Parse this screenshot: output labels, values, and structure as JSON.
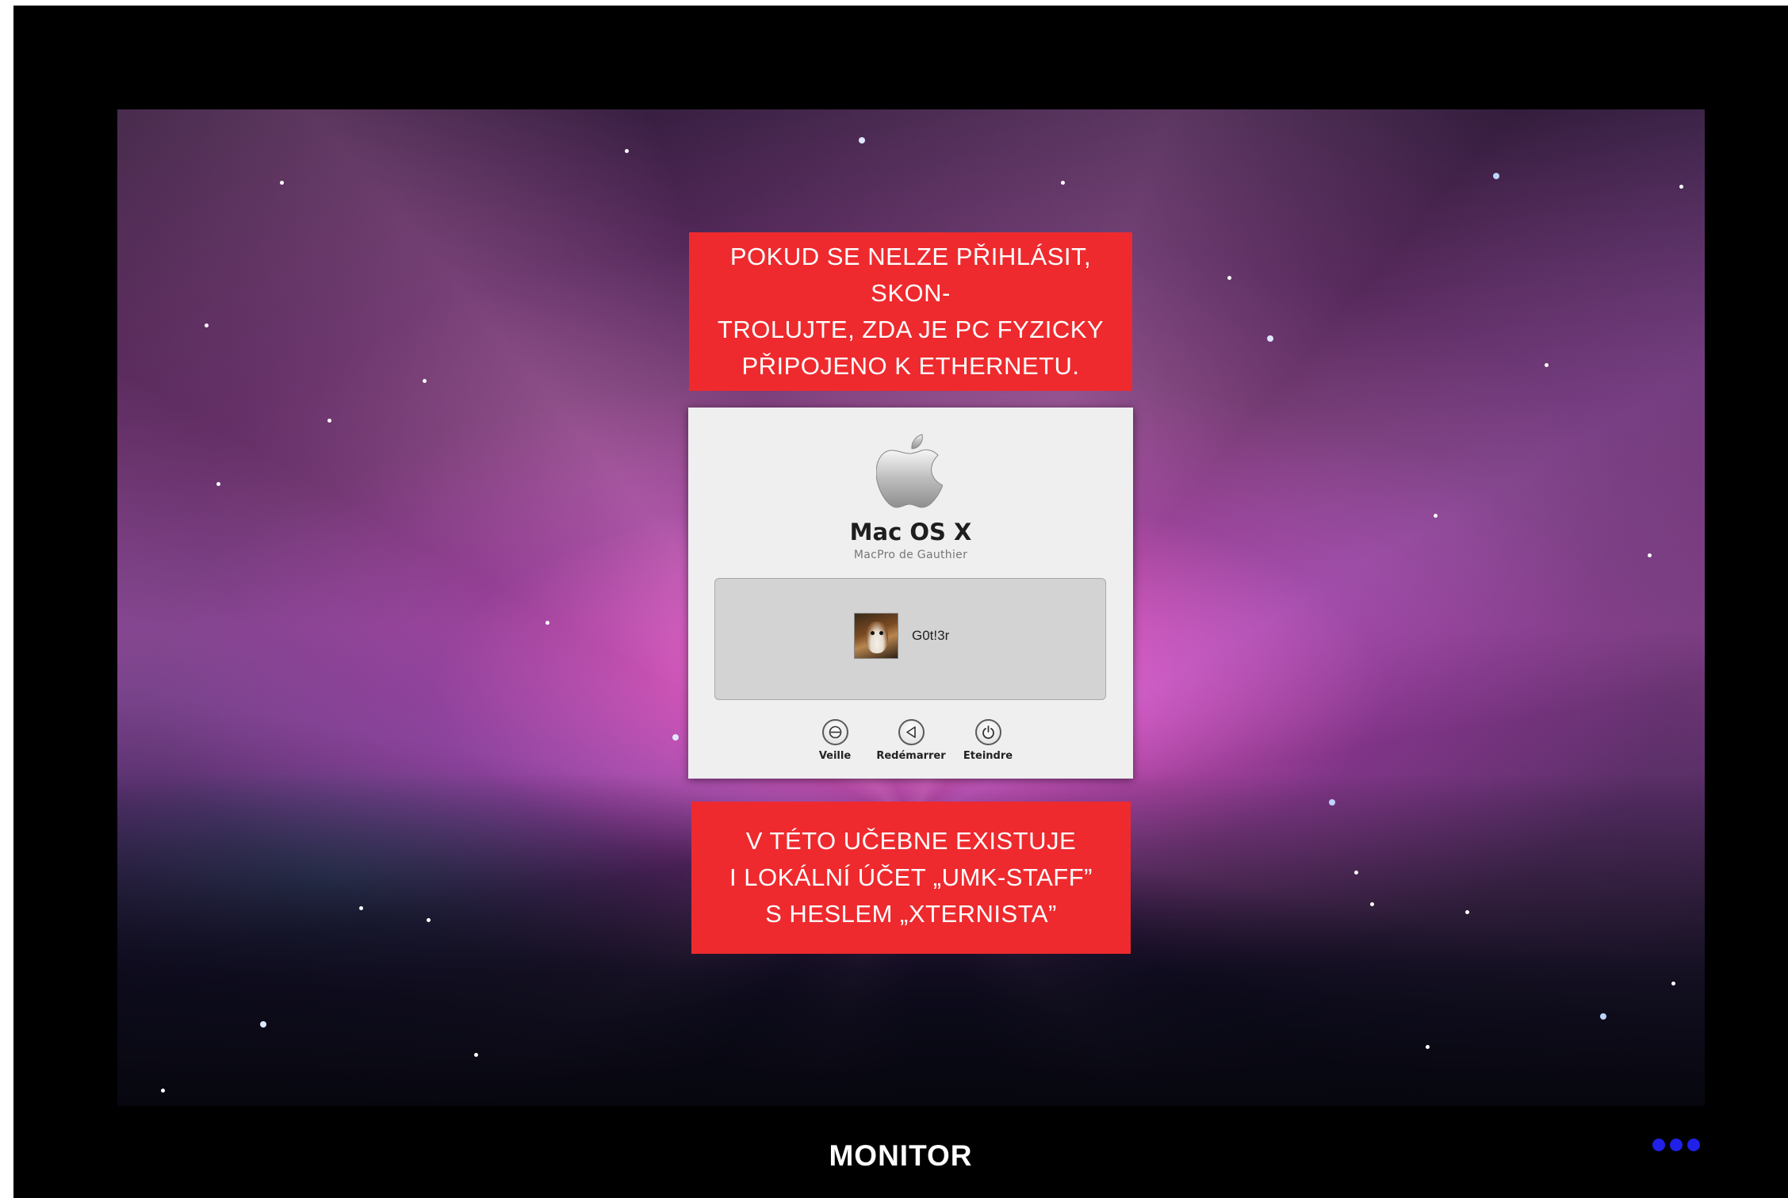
{
  "notes": {
    "top": "POKUD SE NELZE PŘIHLÁSIT, SKON-\nTROLUJTE, ZDA JE PC FYZICKY\nPŘIPOJENO K ETHERNETU.",
    "bottom": "V TÉTO UČEBNE EXISTUJE\nI LOKÁLNÍ ÚČET  „UMK-STAFF”\nS HESLEM „XTERNISTA”"
  },
  "login": {
    "os_title": "Mac OS X",
    "host_name": "MacPro de Gauthier",
    "user": {
      "name": "G0t!3r",
      "avatar_icon": "boxer-dog-avatar"
    },
    "power_buttons": [
      {
        "label": "Veille",
        "icon": "sleep-icon"
      },
      {
        "label": "Redémarrer",
        "icon": "restart-icon"
      },
      {
        "label": "Eteindre",
        "icon": "power-icon"
      }
    ]
  },
  "footer": {
    "label": "MONITOR",
    "dots_color": "#2020e8"
  },
  "colors": {
    "note_background": "#ee2a2e",
    "login_background": "#efefef",
    "frame": "#000000"
  }
}
